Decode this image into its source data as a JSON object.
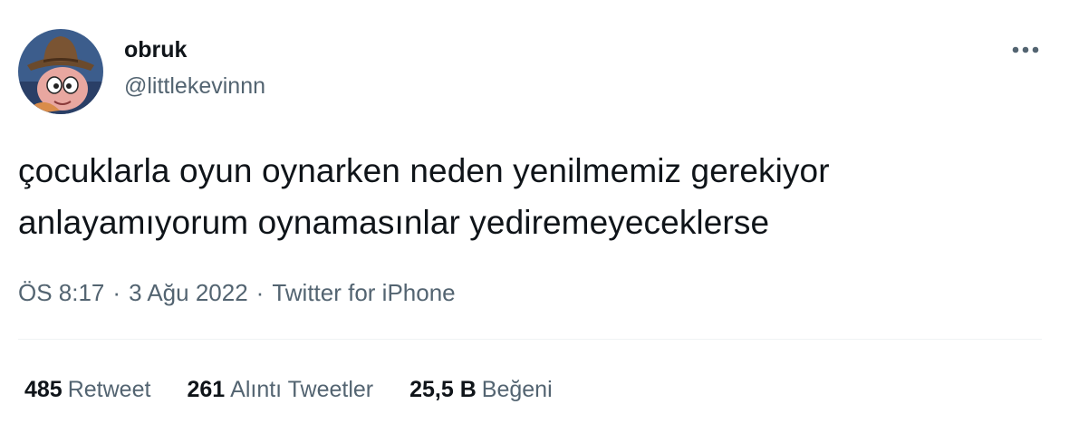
{
  "user": {
    "display_name": "obruk",
    "handle": "@littlekevinnn",
    "avatar": "cartoon-cowboy-avatar-icon"
  },
  "tweet": {
    "text_line1": "çocuklarla oyun oynarken neden yenilmemiz gerekiyor",
    "text_line2": "anlayamıyorum oynamasınlar yediremeyeceklerse"
  },
  "meta": {
    "time": "ÖS 8:17",
    "date": "3 Ağu 2022",
    "source": "Twitter for iPhone",
    "separator": "·"
  },
  "stats": {
    "retweets": {
      "count": "485",
      "label": "Retweet"
    },
    "quotes": {
      "count": "261",
      "label": "Alıntı Tweetler"
    },
    "likes": {
      "count": "25,5 B",
      "label": "Beğeni"
    }
  },
  "icons": {
    "more": "more-horizontal-icon"
  },
  "colors": {
    "primary_text": "#0f1419",
    "secondary_text": "#536471",
    "divider": "#eff3f4"
  }
}
